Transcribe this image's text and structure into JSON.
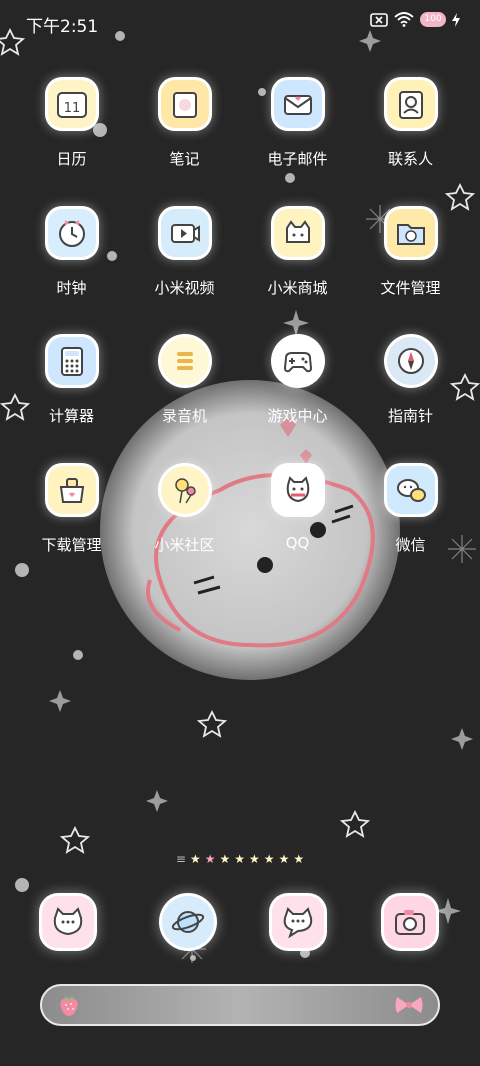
{
  "status_bar": {
    "time": "下午2:51",
    "battery": "100"
  },
  "apps": [
    {
      "label": "日历",
      "icon": "calendar-icon",
      "badge": "11",
      "color": "#fff4c8"
    },
    {
      "label": "笔记",
      "icon": "notes-icon",
      "color": "#ffe7a8"
    },
    {
      "label": "电子邮件",
      "icon": "mail-icon",
      "color": "#cfe6ff"
    },
    {
      "label": "联系人",
      "icon": "contacts-icon",
      "color": "#fff2b8"
    },
    {
      "label": "时钟",
      "icon": "clock-icon",
      "color": "#d9eefc"
    },
    {
      "label": "小米视频",
      "icon": "video-icon",
      "color": "#d6ecfb"
    },
    {
      "label": "小米商城",
      "icon": "mall-icon",
      "color": "#fff3c2"
    },
    {
      "label": "文件管理",
      "icon": "files-icon",
      "color": "#ffe9a8"
    },
    {
      "label": "计算器",
      "icon": "calculator-icon",
      "color": "#cfe6ff"
    },
    {
      "label": "录音机",
      "icon": "recorder-icon",
      "color": "#fff8d6"
    },
    {
      "label": "游戏中心",
      "icon": "gamepad-icon",
      "color": "#ffffff"
    },
    {
      "label": "指南针",
      "icon": "compass-icon",
      "color": "#dbe8f5"
    },
    {
      "label": "下载管理",
      "icon": "download-icon",
      "color": "#fff3c2"
    },
    {
      "label": "小米社区",
      "icon": "community-icon",
      "color": "#fff4c8"
    },
    {
      "label": "QQ",
      "icon": "qq-icon",
      "color": "#ffffff"
    },
    {
      "label": "微信",
      "icon": "wechat-icon",
      "color": "#cfeafc"
    }
  ],
  "page_indicator": {
    "pages": 8,
    "current": 2
  },
  "dock": [
    {
      "icon": "cat-phone-icon",
      "color": "#ffe1ec"
    },
    {
      "icon": "planet-icon",
      "color": "#d6ecfb"
    },
    {
      "icon": "cat-message-icon",
      "color": "#ffe1ec"
    },
    {
      "icon": "camera-icon",
      "color": "#ffd6e4"
    }
  ],
  "search_bar": {
    "left_icon": "strawberry-icon",
    "right_icon": "bow-icon"
  }
}
